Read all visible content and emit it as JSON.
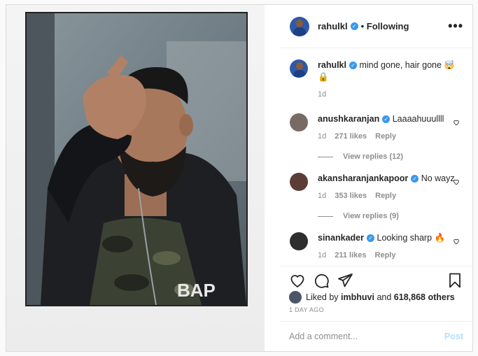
{
  "post": {
    "author": "rahulkl",
    "follow_status": "• Following",
    "more_glyph": "•••",
    "caption_text": "mind gone, hair gone 🤯 🔒",
    "caption_time": "1d"
  },
  "comments": [
    {
      "user": "anushkaranjan",
      "text": "Laaaahuuullll",
      "time": "1d",
      "likes": "271 likes",
      "reply": "Reply",
      "view_replies": "View replies (12)",
      "avatar_color": "#7a6a65"
    },
    {
      "user": "akansharanjankapoor",
      "text": "No wayz",
      "time": "1d",
      "likes": "353 likes",
      "reply": "Reply",
      "view_replies": "View replies (9)",
      "avatar_color": "#5a3e35"
    },
    {
      "user": "sinankader",
      "text": "Looking sharp 🔥",
      "time": "1d",
      "likes": "211 likes",
      "reply": "Reply",
      "avatar_color": "#2e2e2e"
    }
  ],
  "likes": {
    "prefix": "Liked by ",
    "user": "imbhuvi",
    "middle": " and ",
    "count": "618,868 others"
  },
  "timestamp": "1 DAY AGO",
  "comment_input": {
    "placeholder": "Add a comment...",
    "post_label": "Post"
  },
  "colors": {
    "verified": "#3897f0",
    "post_disabled": "#b2dffc",
    "muted": "#8e8e8e"
  },
  "icons": [
    "heart-icon",
    "comment-icon",
    "share-icon",
    "bookmark-icon",
    "verified-badge-icon"
  ]
}
